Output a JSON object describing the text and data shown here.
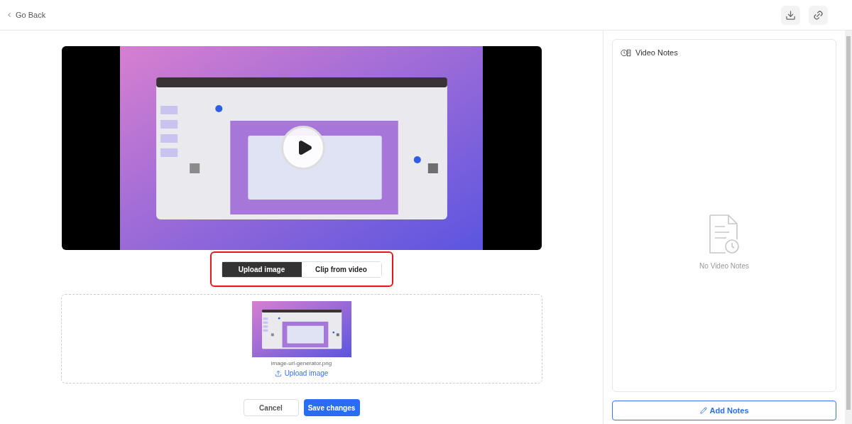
{
  "header": {
    "back_label": "Go Back"
  },
  "source_tabs": [
    {
      "label": "Upload image",
      "selected": true
    },
    {
      "label": "Clip from video",
      "selected": false
    }
  ],
  "upload": {
    "filename": "image-url-generator.png",
    "link": "Upload image"
  },
  "actions": {
    "cancel": "Cancel",
    "save": "Save changes"
  },
  "notes": {
    "title": "Video Notes",
    "empty_text": "No Video Notes",
    "add_button": "Add Notes"
  }
}
